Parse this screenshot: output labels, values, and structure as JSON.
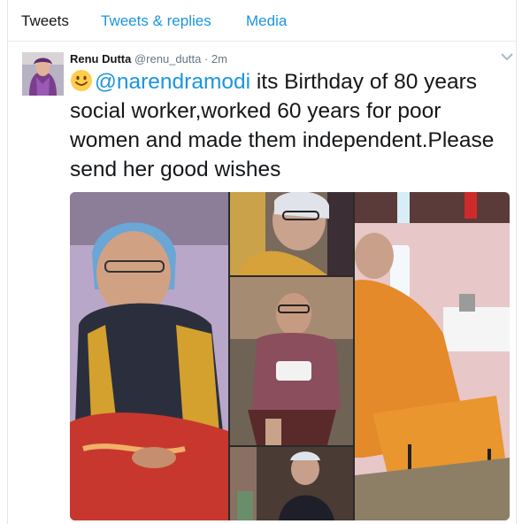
{
  "tabs": [
    {
      "label": "Tweets",
      "active": true
    },
    {
      "label": "Tweets & replies",
      "active": false
    },
    {
      "label": "Media",
      "active": false
    }
  ],
  "tweet": {
    "author": "Renu Dutta",
    "handle": "@renu_dutta",
    "separator": "·",
    "time": "2m",
    "emoji": "smiling-face-emoji",
    "mention": "@narendramodi",
    "text": "its Birthday of 80 years social worker,worked 60 years for poor women and made them independent.Please send her good wishes"
  },
  "colors": {
    "link": "#1b95e0",
    "text": "#14171a",
    "muted": "#657786",
    "border": "#e6ecf0"
  },
  "icons": {
    "menu": "chevron-down-icon"
  }
}
